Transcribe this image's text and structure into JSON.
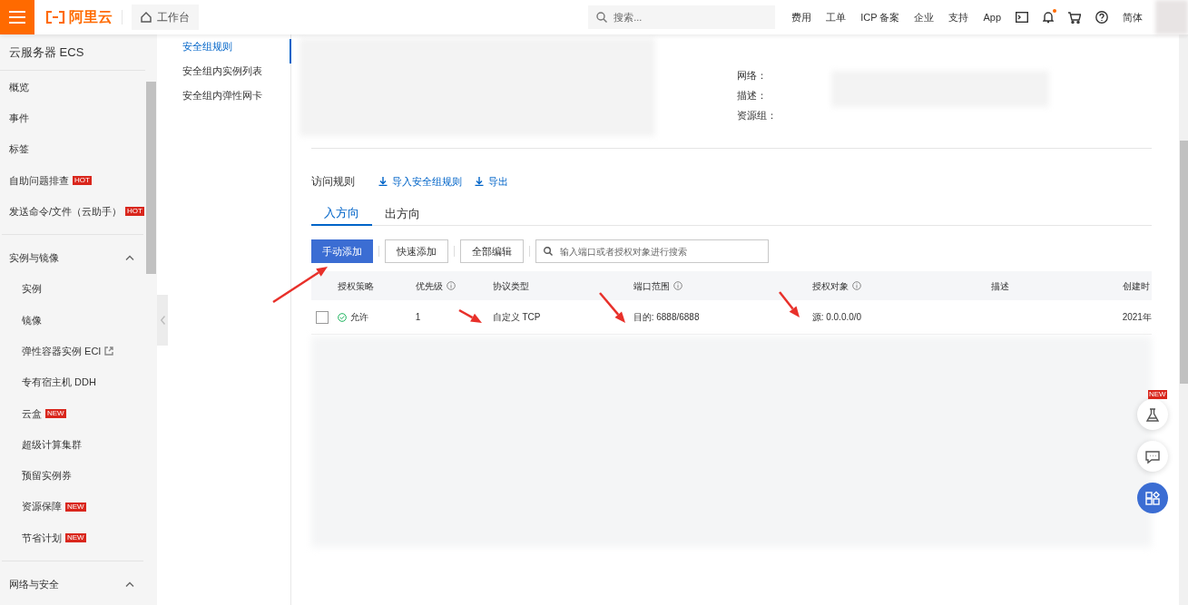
{
  "top_bar": {
    "logo": "阿里云",
    "workbench": "工作台",
    "search": {
      "placeholder": "搜索..."
    },
    "links": [
      "费用",
      "工单",
      "ICP 备案",
      "企业",
      "支持",
      "App"
    ],
    "notification_dot": true,
    "language": "简体"
  },
  "sidebar": {
    "title": "云服务器 ECS",
    "items": [
      {
        "label": "概览"
      },
      {
        "label": "事件"
      },
      {
        "label": "标签"
      },
      {
        "label": "自助问题排查",
        "badge": "HOT"
      },
      {
        "label": "发送命令/文件（云助手）",
        "badge": "HOT"
      }
    ],
    "groups": [
      {
        "label": "实例与镜像",
        "expanded": true,
        "children": [
          {
            "label": "实例",
            "external": false
          },
          {
            "label": "镜像",
            "external": false
          },
          {
            "label": "弹性容器实例 ECI",
            "external": true
          },
          {
            "label": "专有宿主机 DDH",
            "external": false
          },
          {
            "label": "云盒",
            "badge": "NEW",
            "external": false
          },
          {
            "label": "超级计算集群",
            "external": false
          },
          {
            "label": "预留实例券",
            "external": false
          },
          {
            "label": "资源保障",
            "badge": "NEW",
            "external": false
          },
          {
            "label": "节省计划",
            "badge": "NEW",
            "external": false
          }
        ]
      },
      {
        "label": "网络与安全",
        "expanded": true
      }
    ]
  },
  "sub_nav": [
    {
      "label": "安全组规则",
      "selected": true
    },
    {
      "label": "安全组内实例列表",
      "selected": false
    },
    {
      "label": "安全组内弹性网卡",
      "selected": false
    }
  ],
  "info": {
    "fields": [
      {
        "label": "网络："
      },
      {
        "label": "描述："
      },
      {
        "label": "资源组："
      }
    ]
  },
  "rules": {
    "title": "访问规则",
    "actions": [
      "导入安全组规则",
      "导出"
    ],
    "tabs": [
      {
        "label": "入方向",
        "selected": true
      },
      {
        "label": "出方向",
        "selected": false
      }
    ],
    "toolbar": [
      {
        "label": "手动添加",
        "kind": "primary"
      },
      {
        "label": "快速添加",
        "kind": "default"
      },
      {
        "label": "全部编辑",
        "kind": "default"
      }
    ],
    "search": {
      "placeholder": "输入端口或者授权对象进行搜索"
    },
    "columns": [
      {
        "label": "授权策略",
        "info": false
      },
      {
        "label": "优先级",
        "info": true
      },
      {
        "label": "协议类型",
        "info": false
      },
      {
        "label": "端口范围",
        "info": true
      },
      {
        "label": "授权对象",
        "info": true
      },
      {
        "label": "描述",
        "info": false
      },
      {
        "label": "创建时",
        "info": false
      }
    ],
    "rows": [
      {
        "checked": false,
        "policy": "允许",
        "priority": "1",
        "protocol": "自定义 TCP",
        "port": "目的: 6888/6888",
        "object": "源: 0.0.0.0/0",
        "created": "2021年"
      }
    ]
  },
  "floating": [
    {
      "kind": "lab",
      "badge": "NEW"
    },
    {
      "kind": "chat"
    },
    {
      "kind": "apps"
    }
  ]
}
